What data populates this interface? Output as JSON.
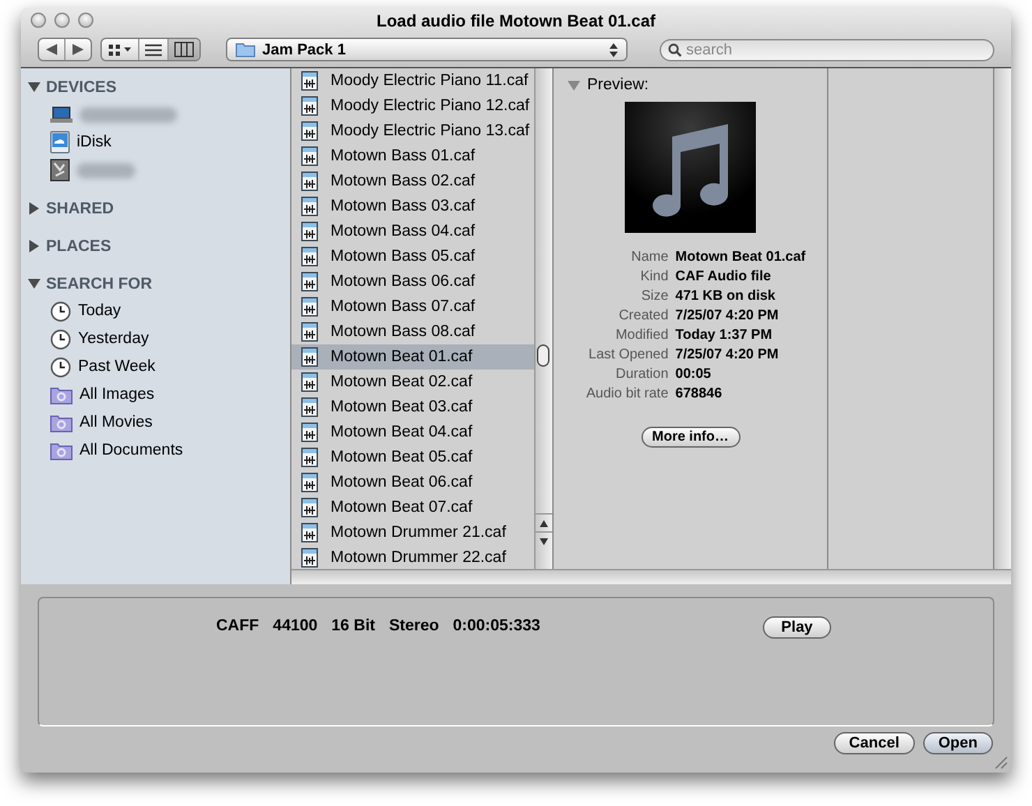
{
  "window": {
    "title": "Load audio file Motown Beat 01.caf"
  },
  "toolbar": {
    "views": [
      {
        "kind": "icons",
        "selected": false
      },
      {
        "kind": "list",
        "selected": false
      },
      {
        "kind": "columns",
        "selected": true
      }
    ],
    "location": "Jam Pack 1",
    "search": {
      "placeholder": "search"
    }
  },
  "sidebar": {
    "sections": [
      {
        "title": "DEVICES",
        "expanded": true,
        "items": [
          {
            "kind": "laptop"
          },
          {
            "kind": "idisk",
            "label": "iDisk"
          },
          {
            "kind": "disk"
          }
        ]
      },
      {
        "title": "SHARED",
        "expanded": false
      },
      {
        "title": "PLACES",
        "expanded": false
      },
      {
        "title": "SEARCH FOR",
        "expanded": true,
        "items": [
          {
            "kind": "clock",
            "label": "Today"
          },
          {
            "kind": "clock",
            "label": "Yesterday"
          },
          {
            "kind": "clock",
            "label": "Past Week"
          },
          {
            "kind": "smart-folder",
            "label": "All Images"
          },
          {
            "kind": "smart-folder",
            "label": "All Movies"
          },
          {
            "kind": "smart-folder",
            "label": "All Documents"
          }
        ]
      }
    ]
  },
  "files": [
    {
      "name": "Moody Electric Piano 11.caf",
      "selected": false
    },
    {
      "name": "Moody Electric Piano 12.caf",
      "selected": false
    },
    {
      "name": "Moody Electric Piano 13.caf",
      "selected": false
    },
    {
      "name": "Motown Bass 01.caf",
      "selected": false
    },
    {
      "name": "Motown Bass 02.caf",
      "selected": false
    },
    {
      "name": "Motown Bass 03.caf",
      "selected": false
    },
    {
      "name": "Motown Bass 04.caf",
      "selected": false
    },
    {
      "name": "Motown Bass 05.caf",
      "selected": false
    },
    {
      "name": "Motown Bass 06.caf",
      "selected": false
    },
    {
      "name": "Motown Bass 07.caf",
      "selected": false
    },
    {
      "name": "Motown Bass 08.caf",
      "selected": false
    },
    {
      "name": "Motown Beat 01.caf",
      "selected": true
    },
    {
      "name": "Motown Beat 02.caf",
      "selected": false
    },
    {
      "name": "Motown Beat 03.caf",
      "selected": false
    },
    {
      "name": "Motown Beat 04.caf",
      "selected": false
    },
    {
      "name": "Motown Beat 05.caf",
      "selected": false
    },
    {
      "name": "Motown Beat 06.caf",
      "selected": false
    },
    {
      "name": "Motown Beat 07.caf",
      "selected": false
    },
    {
      "name": "Motown Drummer 21.caf",
      "selected": false
    },
    {
      "name": "Motown Drummer 22.caf",
      "selected": false
    }
  ],
  "preview": {
    "title": "Preview:",
    "expanded": true,
    "info": [
      {
        "label": "Name",
        "value": "Motown Beat 01.caf"
      },
      {
        "label": "Kind",
        "value": "CAF Audio file"
      },
      {
        "label": "Size",
        "value": "471 KB on disk"
      },
      {
        "label": "Created",
        "value": "7/25/07 4:20 PM"
      },
      {
        "label": "Modified",
        "value": "Today 1:37 PM"
      },
      {
        "label": "Last Opened",
        "value": "7/25/07 4:20 PM"
      },
      {
        "label": "Duration",
        "value": "00:05"
      },
      {
        "label": "Audio bit rate",
        "value": "678846"
      }
    ],
    "more_button": "More info…"
  },
  "audio_panel": {
    "format": [
      "CAFF",
      "44100",
      "16 Bit",
      "Stereo",
      "0:00:05:333"
    ],
    "play_button": "Play"
  },
  "buttons": [
    {
      "label": "Cancel",
      "default": false
    },
    {
      "label": "Open",
      "default": true
    }
  ]
}
